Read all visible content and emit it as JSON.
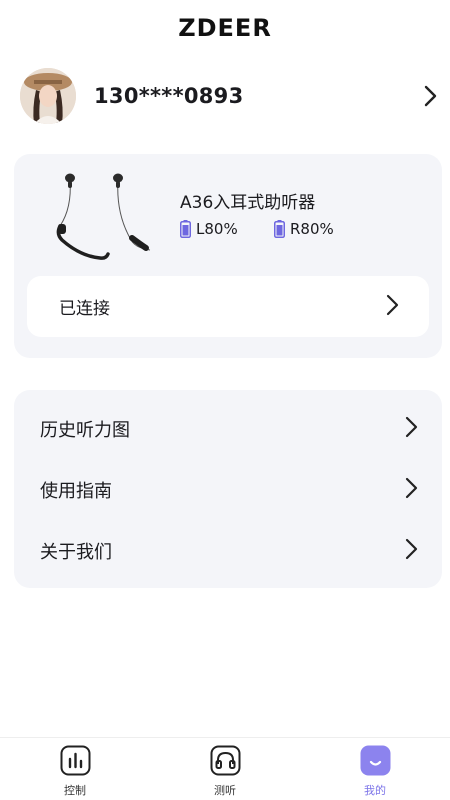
{
  "header": {
    "title": "ZDEER"
  },
  "profile": {
    "phone": "130****0893",
    "avatar_icon": "user-avatar-photo"
  },
  "device": {
    "name": "A36入耳式助听器",
    "battery_left": "L80%",
    "battery_right": "R80%",
    "battery_level_left": 0.8,
    "battery_level_right": 0.8,
    "status": "已连接"
  },
  "menu": {
    "items": [
      {
        "label": "历史听力图"
      },
      {
        "label": "使用指南"
      },
      {
        "label": "关于我们"
      }
    ]
  },
  "tabbar": {
    "tabs": [
      {
        "label": "控制",
        "icon": "bar-chart-icon"
      },
      {
        "label": "测听",
        "icon": "headphones-icon"
      },
      {
        "label": "我的",
        "icon": "smile-icon",
        "active": true
      }
    ]
  },
  "colors": {
    "accent": "#7c74e8",
    "card_bg": "#f4f5f9",
    "battery": "#6e67e0"
  }
}
